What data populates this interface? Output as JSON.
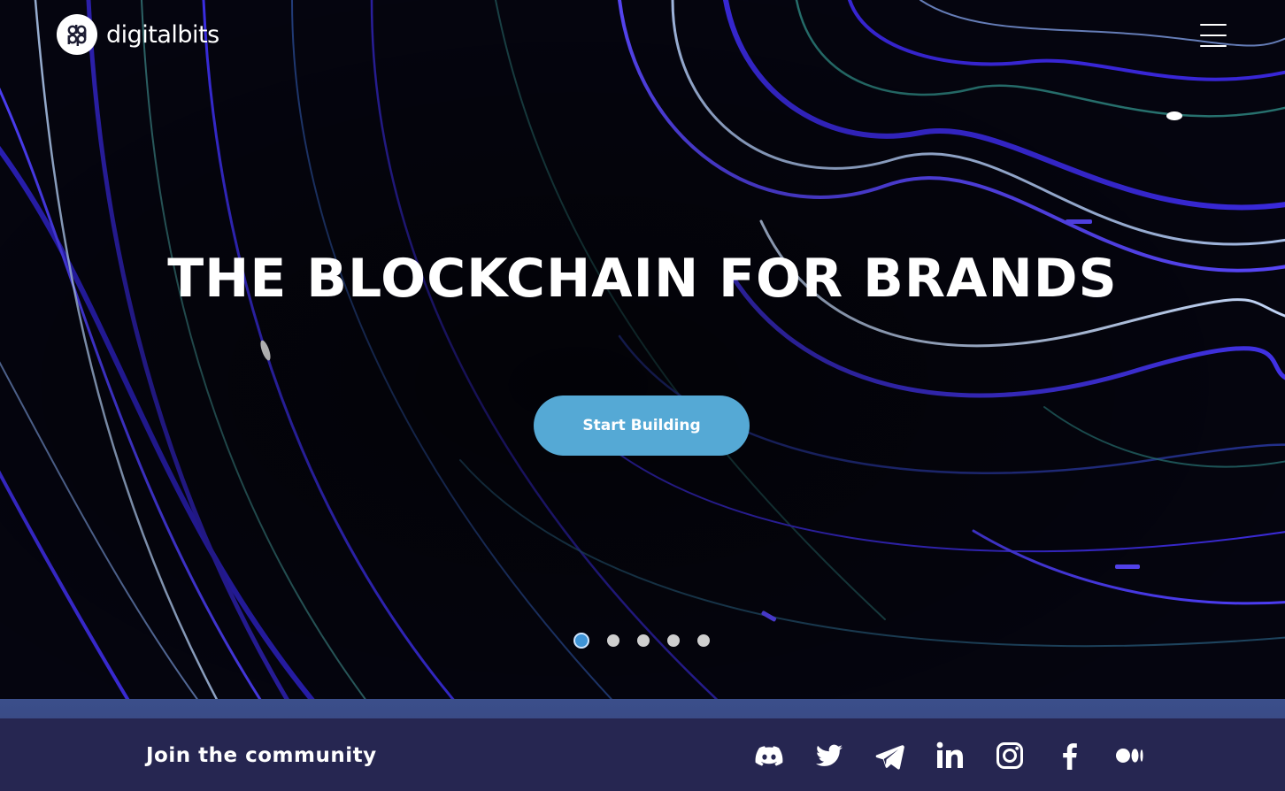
{
  "brand": {
    "name": "digitalbits",
    "logo_icon": "digitalbits-logo-icon"
  },
  "nav": {
    "menu_icon": "hamburger-menu-icon"
  },
  "hero": {
    "headline": "THE BLOCKCHAIN FOR BRANDS",
    "cta_label": "Start Building",
    "slides": [
      {
        "active": true
      },
      {
        "active": false
      },
      {
        "active": false
      },
      {
        "active": false
      },
      {
        "active": false
      }
    ]
  },
  "footer": {
    "join_text": "Join the community",
    "socials": [
      {
        "icon": "discord-icon"
      },
      {
        "icon": "twitter-icon"
      },
      {
        "icon": "telegram-icon"
      },
      {
        "icon": "linkedin-icon"
      },
      {
        "icon": "instagram-icon"
      },
      {
        "icon": "facebook-icon"
      },
      {
        "icon": "medium-icon"
      }
    ]
  },
  "colors": {
    "cta": "#55a9d5",
    "footer_bg": "#262651",
    "active_dot": "#3f94d6",
    "accent_blue": "#3d2cf0"
  }
}
